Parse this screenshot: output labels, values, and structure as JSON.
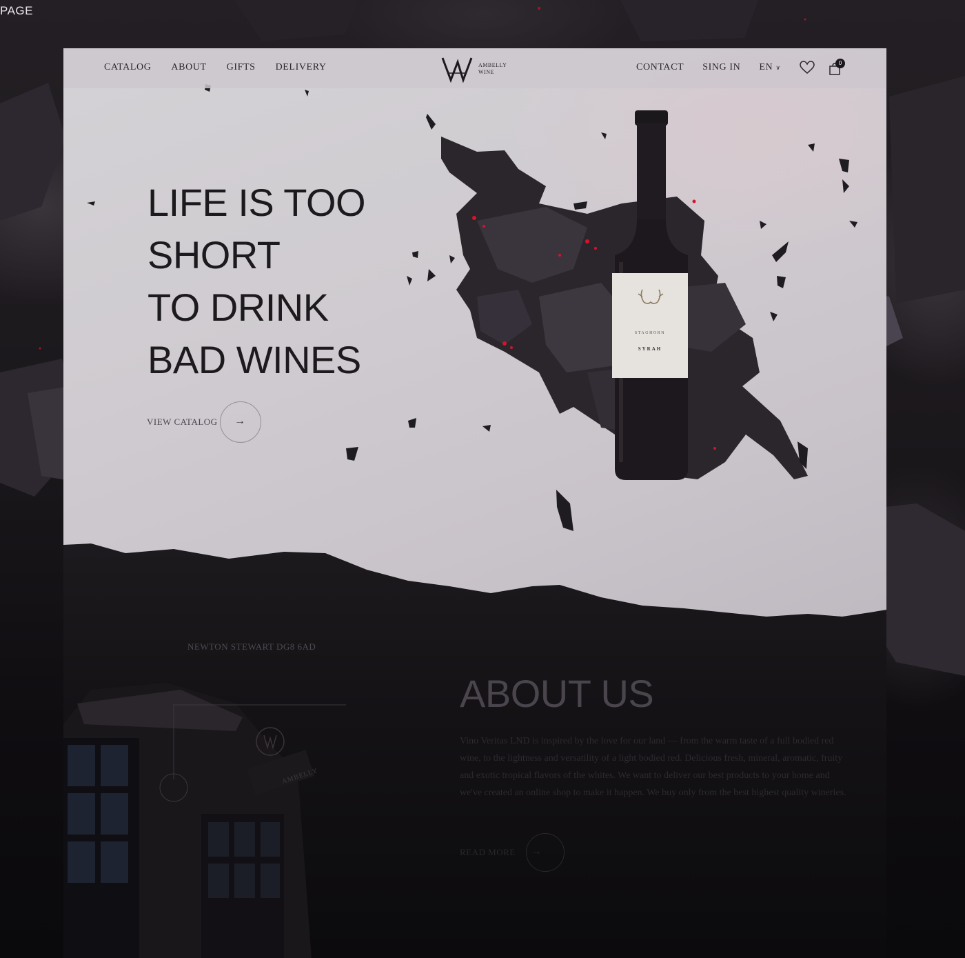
{
  "page": {
    "corner_label": "PAGE"
  },
  "nav": {
    "left_links": [
      "CATALOG",
      "ABOUT",
      "GIFTS",
      "DELIVERY"
    ],
    "logo_text_line1": "AMBELLY",
    "logo_text_line2": "WINE",
    "contact": "CONTACT",
    "sign_in": "SING IN",
    "language": "EN",
    "cart_count": "0"
  },
  "hero": {
    "headline_lines": [
      "LIFE IS TOO",
      "SHORT",
      "TO DRINK",
      "BAD WINES"
    ],
    "cta_label": "VIEW CATALOG"
  },
  "bottle": {
    "label_line1": "STAGHORN",
    "label_line2": "SYRAH"
  },
  "about": {
    "address": "NEWTON STEWART DG8 6AD",
    "title": "ABOUT US",
    "body": "Vino Veritas LND is inspired by the love for our land — from the warm taste of a full bodied red wine, to the lightness and versatility of a light bodied red. Delicious fresh, mineral, aromatic, fruity and exotic tropical flavors of the whites. We want to deliver our best products to your home and we've created an online shop to make it happen. We buy only from the best highest quality wineries.",
    "read_more": "READ MORE",
    "sign_text": "AMBELLY"
  },
  "colors": {
    "hero_bg": "#cfcbd0",
    "dark_bg": "#0f0d10",
    "ember": "#d9122b"
  }
}
